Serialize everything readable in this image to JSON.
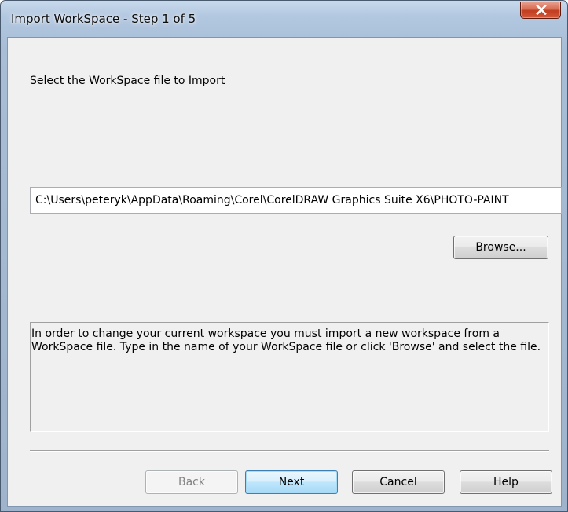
{
  "window": {
    "title": "Import WorkSpace - Step 1 of 5",
    "close_icon": "close-x-icon"
  },
  "main": {
    "prompt": "Select the WorkSpace file to Import",
    "path_value": "C:\\Users\\peteryk\\AppData\\Roaming\\Corel\\CorelDRAW Graphics Suite X6\\PHOTO-PAINT",
    "browse_label": "Browse...",
    "info_text": "In order to change your current workspace you must import a new workspace from a WorkSpace file. Type in the name of your WorkSpace file or click 'Browse' and select the file."
  },
  "footer": {
    "back_label": "Back",
    "next_label": "Next",
    "cancel_label": "Cancel",
    "help_label": "Help"
  },
  "colors": {
    "title_bar": "#b2c7e0",
    "close_button": "#c13d1f",
    "dialog_background": "#f0f0f0",
    "default_button_border": "#3c7fb1"
  }
}
